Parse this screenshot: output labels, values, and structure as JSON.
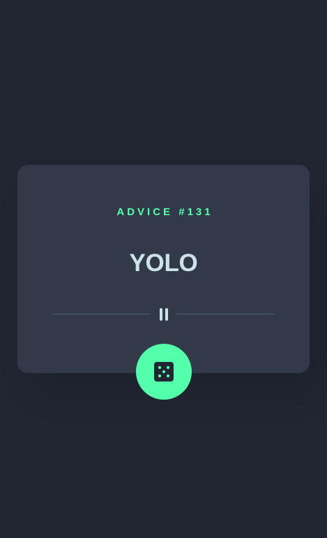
{
  "advice": {
    "id_label": "ADVICE #131",
    "text": "YOLO"
  },
  "divider": {
    "icon": "pause-icon"
  },
  "generate_button": {
    "icon": "dice-icon"
  },
  "colors": {
    "background": "#202632",
    "card": "#323a49",
    "accent": "#53ffaa",
    "text": "#cee3e9",
    "divider": "#4f5d74"
  }
}
